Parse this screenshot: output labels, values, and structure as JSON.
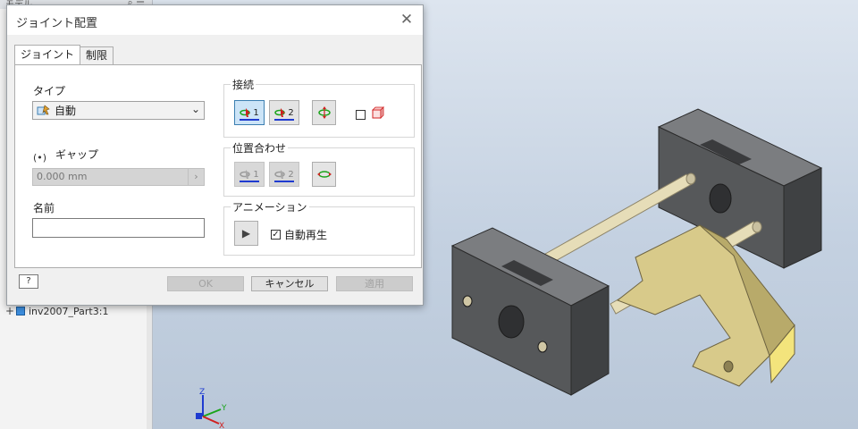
{
  "browser": {
    "header_text": "モデル",
    "header_icons": "⌕ ☰",
    "tree_item_label": "inv2007_Part3:1"
  },
  "dialog": {
    "title": "ジョイント配置",
    "close_glyph": "✕",
    "tabs": [
      {
        "label": "ジョイント",
        "active": true
      },
      {
        "label": "制限",
        "active": false
      }
    ],
    "type": {
      "label": "タイプ",
      "selected": "自動"
    },
    "gap": {
      "label": "ギャップ",
      "value": "0.000 mm",
      "enabled": false
    },
    "name": {
      "label": "名前",
      "value": ""
    },
    "connect": {
      "title": "接続",
      "buttons": [
        {
          "name": "origin-1",
          "number": "1",
          "pressed": true
        },
        {
          "name": "origin-2",
          "number": "2",
          "pressed": false
        },
        {
          "name": "flip",
          "number": "",
          "pressed": false
        }
      ],
      "checkbox_checked": false
    },
    "align": {
      "title": "位置合わせ",
      "buttons": [
        {
          "name": "align-1",
          "number": "1",
          "enabled": false
        },
        {
          "name": "align-2",
          "number": "2",
          "enabled": false
        },
        {
          "name": "align-flip",
          "number": "",
          "enabled": true
        }
      ]
    },
    "animation": {
      "title": "アニメーション",
      "autoplay_label": "自動再生",
      "autoplay_checked": true
    },
    "footer": {
      "help": "?",
      "ok": "OK",
      "cancel": "キャンセル",
      "apply": "適用"
    }
  },
  "triad": {
    "x": "X",
    "y": "Y",
    "z": "Z"
  },
  "colors": {
    "accent_blue": "#3c7fb1",
    "block_dark": "#5d5f61",
    "rod": "#d9d0a8",
    "bracket": "#d8ca8a"
  }
}
